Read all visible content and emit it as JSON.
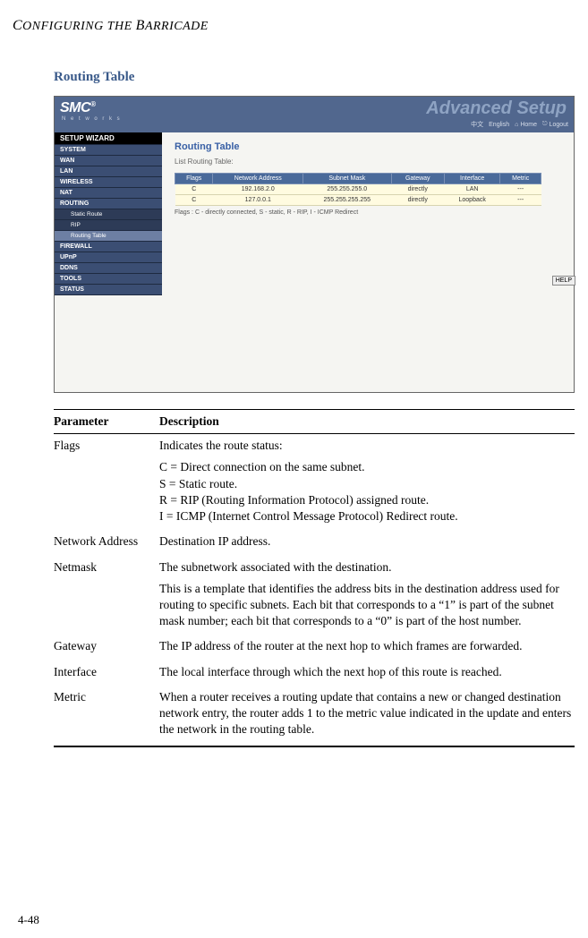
{
  "running_head": "CONFIGURING THE BARRICADE",
  "section_title": "Routing Table",
  "screenshot": {
    "logo": "SMC",
    "logo_reg": "®",
    "logo_sub": "N e t w o r k s",
    "adv_title": "Advanced Setup",
    "topbar": {
      "lang1": "中文",
      "lang2": "English",
      "home": "Home",
      "logout": "Logout"
    },
    "sidebar": {
      "wizard": "SETUP WIZARD",
      "items": [
        "SYSTEM",
        "WAN",
        "LAN",
        "WIRELESS",
        "NAT",
        "ROUTING"
      ],
      "subs": [
        "Static Route",
        "RIP",
        "Routing Table"
      ],
      "items2": [
        "FIREWALL",
        "UPnP",
        "DDNS",
        "TOOLS",
        "STATUS"
      ]
    },
    "main": {
      "title": "Routing Table",
      "subtitle": "List Routing Table:",
      "headers": [
        "Flags",
        "Network Address",
        "Subnet Mask",
        "Gateway",
        "Interface",
        "Metric"
      ],
      "rows": [
        {
          "flags": "C",
          "addr": "192.168.2.0",
          "mask": "255.255.255.0",
          "gw": "directly",
          "iface": "LAN",
          "metric": "---"
        },
        {
          "flags": "C",
          "addr": "127.0.0.1",
          "mask": "255.255.255.255",
          "gw": "directly",
          "iface": "Loopback",
          "metric": "---"
        }
      ],
      "legend": "Flags :   C - directly connected, S - static, R - RIP, I - ICMP Redirect",
      "help": "HELP"
    }
  },
  "param_table": {
    "header": {
      "param": "Parameter",
      "desc": "Description"
    },
    "rows": [
      {
        "param": "Flags",
        "desc": [
          "Indicates the route status:",
          "C = Direct connection on the same subnet.\nS = Static route.\nR = RIP (Routing Information Protocol) assigned route.\nI = ICMP (Internet Control Message Protocol) Redirect route."
        ]
      },
      {
        "param": "Network Address",
        "desc": [
          "Destination IP address."
        ]
      },
      {
        "param": "Netmask",
        "desc": [
          "The subnetwork associated with the destination.",
          "This is a template that identifies the address bits in the destination address used for routing to specific subnets. Each bit that corresponds to a “1” is part of the subnet mask number; each bit that corresponds to a “0” is part of the host number."
        ]
      },
      {
        "param": "Gateway",
        "desc": [
          "The IP address of the router at the next hop to which frames are forwarded."
        ]
      },
      {
        "param": "Interface",
        "desc": [
          "The local interface through which the next hop of this route is reached."
        ]
      },
      {
        "param": "Metric",
        "desc": [
          "When a router receives a routing update that contains a new or changed destination network entry, the router adds 1 to the metric value indicated in the update and enters the network in the routing table."
        ]
      }
    ]
  },
  "page_number": "4-48"
}
